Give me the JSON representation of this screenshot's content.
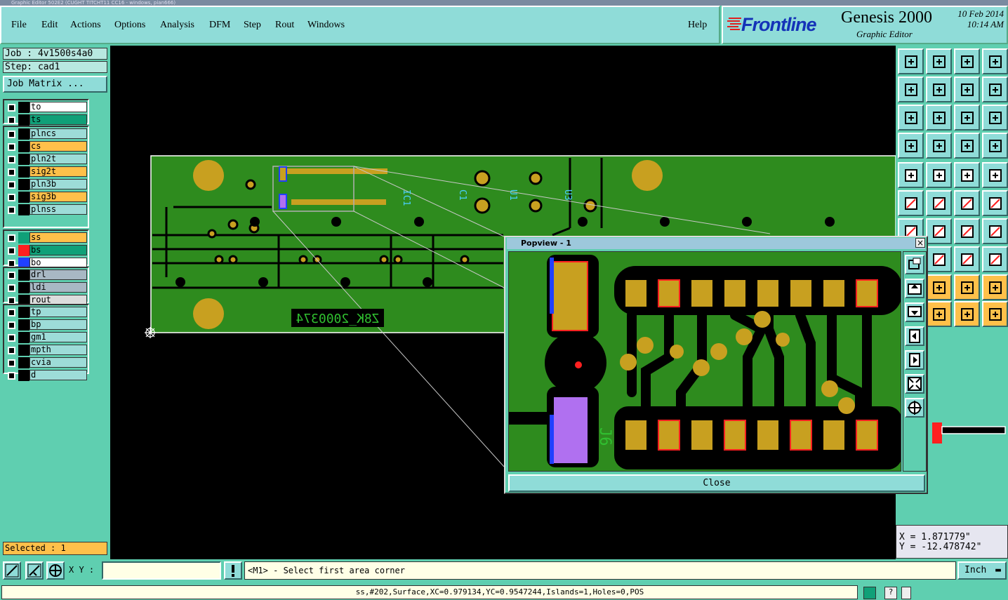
{
  "window": {
    "title": "Graphic Editor 502E2 (CUGHT TITCHT11 CC16 - windows, pian666)"
  },
  "menu": {
    "items": [
      "File",
      "Edit",
      "Actions",
      "Options",
      "Analysis",
      "DFM",
      "Step",
      "Rout",
      "Windows"
    ],
    "help": "Help"
  },
  "brand": {
    "name": "Frontline",
    "product": "Genesis 2000",
    "subtitle": "Graphic Editor",
    "date": "10 Feb 2014",
    "time": "10:14 AM"
  },
  "job": {
    "job_label": "Job : 4v1500s4a0",
    "step_label": "Step: cad1",
    "matrix_button": "Job Matrix ..."
  },
  "layers": {
    "group1": [
      {
        "name": "to",
        "color": "#ffffff"
      },
      {
        "name": "ts",
        "color": "#10a078"
      }
    ],
    "group2": [
      {
        "name": "plncs",
        "color": "#9ddcd8"
      },
      {
        "name": "cs",
        "color": "#ffc04a"
      },
      {
        "name": "pln2t",
        "color": "#9ddcd8"
      },
      {
        "name": "sig2t",
        "color": "#ffc04a"
      },
      {
        "name": "pln3b",
        "color": "#9ddcd8"
      },
      {
        "name": "sig3b",
        "color": "#ffc04a"
      },
      {
        "name": "plnss",
        "color": "#9ddcd8"
      }
    ],
    "group3": [
      {
        "name": "ss",
        "color": "#ffc04a",
        "swatch": "#10a078"
      },
      {
        "name": "bs",
        "color": "#10a078",
        "swatch": "#ff2020"
      },
      {
        "name": "bo",
        "color": "#ffffff",
        "swatch": "#2040ff"
      }
    ],
    "group4": [
      {
        "name": "drl",
        "color": "#a8b8c4"
      },
      {
        "name": "ldi",
        "color": "#a8b8c4"
      },
      {
        "name": "rout",
        "color": "#dcdcdc"
      }
    ],
    "group5": [
      {
        "name": "tp",
        "color": "#9ddcd8"
      },
      {
        "name": "bp",
        "color": "#9ddcd8"
      },
      {
        "name": "gm1",
        "color": "#9ddcd8"
      },
      {
        "name": "mpth",
        "color": "#9ddcd8"
      },
      {
        "name": "cvia",
        "color": "#9ddcd8"
      },
      {
        "name": "d",
        "color": "#9ddcd8"
      }
    ]
  },
  "selected": "Selected : 1",
  "board": {
    "silk_text": "Z8K_2000374",
    "refdes": [
      "IC1",
      "C1",
      "U1",
      "U3"
    ],
    "popup_refdes": "J6"
  },
  "popview": {
    "title": "Popview - 1",
    "close_label": "Close",
    "close_x": "×"
  },
  "coords": {
    "x": "X = 1.871779\"",
    "y": "Y = -12.478742\""
  },
  "bottom": {
    "xy_label": "X Y :",
    "xy_value": "",
    "prompt": "<M1> - Select first area corner",
    "unit": "Inch"
  },
  "status": {
    "text": "ss,#202,Surface,XC=0.979134,YC=0.9547244,Islands=1,Holes=0,POS"
  },
  "colors": {
    "panel": "#5fcfb0",
    "board": "#2e8b1e",
    "pad": "#c8a020",
    "copper_outline": "#000000",
    "highlight": "#ff2020",
    "select": "#2040ff"
  }
}
